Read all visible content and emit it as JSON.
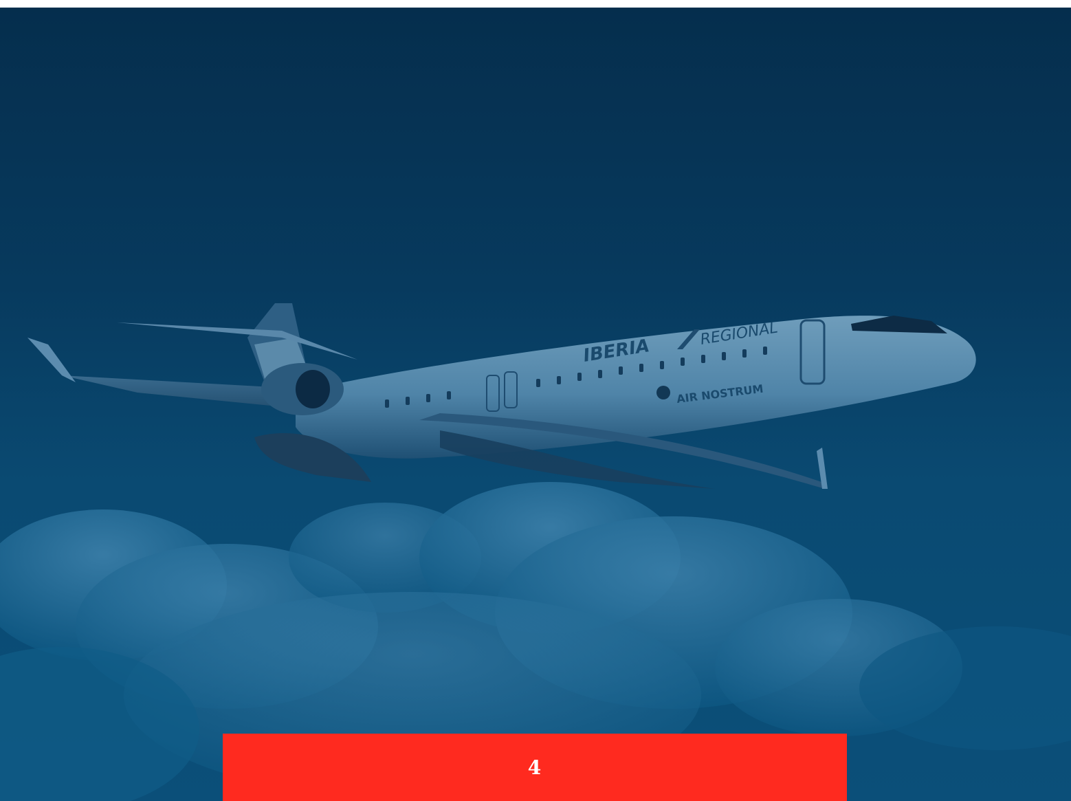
{
  "hero": {
    "livery_primary": "IBERIA",
    "livery_secondary": "REGIONAL",
    "operator": "AIR NOSTRUM",
    "overlay_color": "#073a5e"
  },
  "footer": {
    "page_number": "4",
    "bar_color": "#ff2a1f"
  }
}
